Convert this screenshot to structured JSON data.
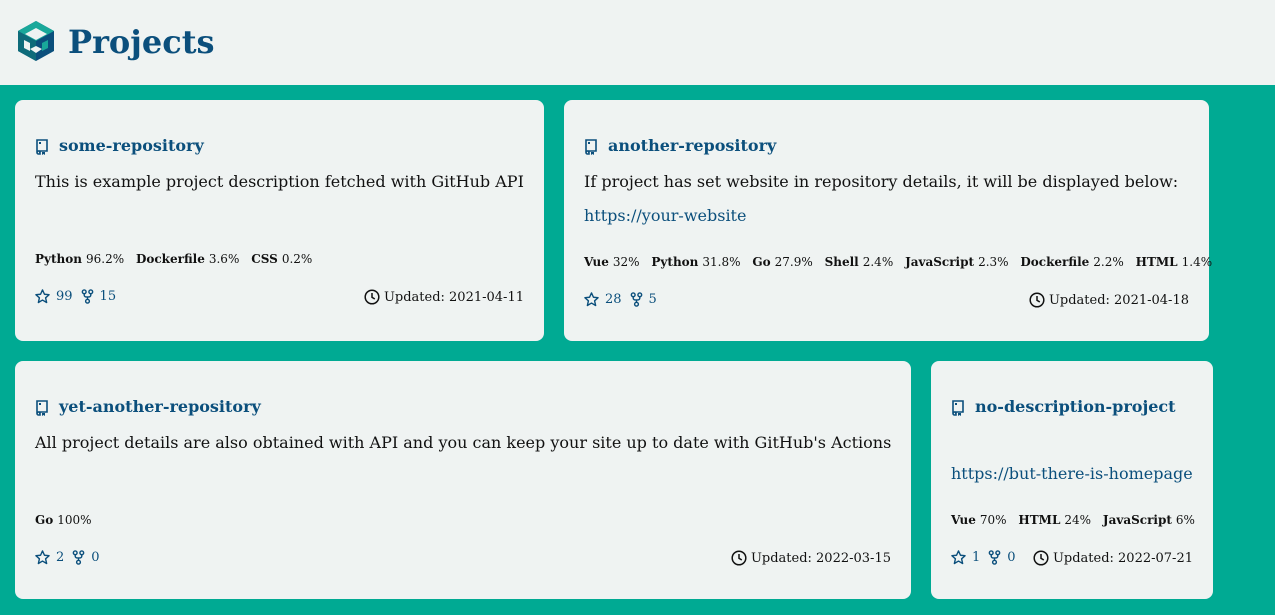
{
  "header": {
    "title": "Projects"
  },
  "colors": {
    "accent": "#00aa93",
    "brand": "#0b4f7c",
    "card": "#eff3f2"
  },
  "projects": [
    {
      "name": "some-repository",
      "description": "This is example project description fetched with GitHub API",
      "website": "",
      "languages": [
        {
          "name": "Python",
          "pct": "96.2%"
        },
        {
          "name": "Dockerfile",
          "pct": "3.6%"
        },
        {
          "name": "CSS",
          "pct": "0.2%"
        }
      ],
      "stars": "99",
      "forks": "15",
      "updated_label": "Updated: 2021-04-11"
    },
    {
      "name": "another-repository",
      "description": "If project has set website in repository details, it will be displayed below:",
      "website": "https://your-website",
      "languages": [
        {
          "name": "Vue",
          "pct": "32%"
        },
        {
          "name": "Python",
          "pct": "31.8%"
        },
        {
          "name": "Go",
          "pct": "27.9%"
        },
        {
          "name": "Shell",
          "pct": "2.4%"
        },
        {
          "name": "JavaScript",
          "pct": "2.3%"
        },
        {
          "name": "Dockerfile",
          "pct": "2.2%"
        },
        {
          "name": "HTML",
          "pct": "1.4%"
        }
      ],
      "stars": "28",
      "forks": "5",
      "updated_label": "Updated: 2021-04-18"
    },
    {
      "name": "yet-another-repository",
      "description": "All project details are also obtained with API and you can keep your site up to date with GitHub's Actions",
      "website": "",
      "languages": [
        {
          "name": "Go",
          "pct": "100%"
        }
      ],
      "stars": "2",
      "forks": "0",
      "updated_label": "Updated: 2022-03-15"
    },
    {
      "name": "no-description-project",
      "description": "",
      "website": "https://but-there-is-homepage",
      "languages": [
        {
          "name": "Vue",
          "pct": "70%"
        },
        {
          "name": "HTML",
          "pct": "24%"
        },
        {
          "name": "JavaScript",
          "pct": "6%"
        }
      ],
      "stars": "1",
      "forks": "0",
      "updated_label": "Updated: 2022-07-21"
    }
  ]
}
